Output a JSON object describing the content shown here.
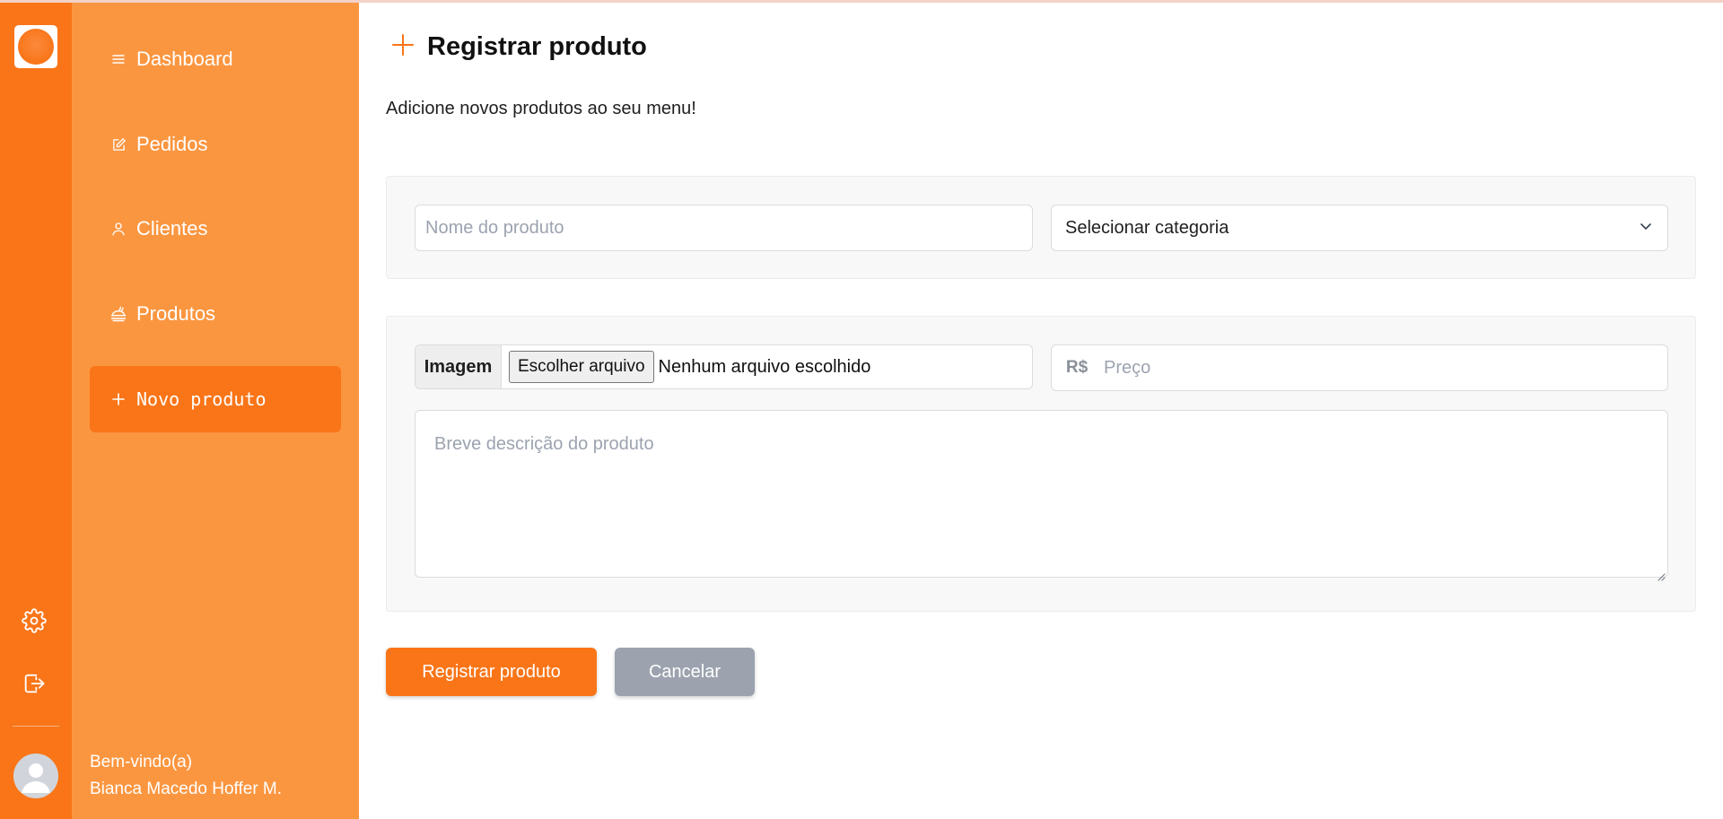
{
  "colors": {
    "brand_orange": "#f97518",
    "sidebar_orange": "#fb9640",
    "panel_bg": "#f8f8f8",
    "cancel_gray": "#9ca3af"
  },
  "rail": {
    "logo_icon": "brand-logo-icon",
    "settings_icon": "gear-icon",
    "logout_icon": "logout-icon",
    "avatar_icon": "user-avatar-icon"
  },
  "sidebar": {
    "items": [
      {
        "label": "Dashboard",
        "icon": "menu-lines-icon"
      },
      {
        "label": "Pedidos",
        "icon": "edit-square-icon"
      },
      {
        "label": "Clientes",
        "icon": "user-icon"
      },
      {
        "label": "Produtos",
        "icon": "food-icon"
      },
      {
        "label": "Novo produto",
        "icon": "plus-icon",
        "active": true
      }
    ],
    "welcome_line": "Bem-vindo(a)",
    "user_name": "Bianca Macedo Hoffer M."
  },
  "page": {
    "title": "Registrar produto",
    "title_icon": "plus-icon",
    "subtitle": "Adicione novos produtos ao seu menu!"
  },
  "form": {
    "name_placeholder": "Nome do produto",
    "category_selected": "Selecionar categoria",
    "image_label": "Imagem",
    "file_button": "Escolher arquivo",
    "file_status": "Nenhum arquivo escolhido",
    "price_prefix": "R$",
    "price_placeholder": "Preço",
    "description_placeholder": "Breve descrição do produto"
  },
  "actions": {
    "submit_label": "Registrar produto",
    "cancel_label": "Cancelar"
  }
}
